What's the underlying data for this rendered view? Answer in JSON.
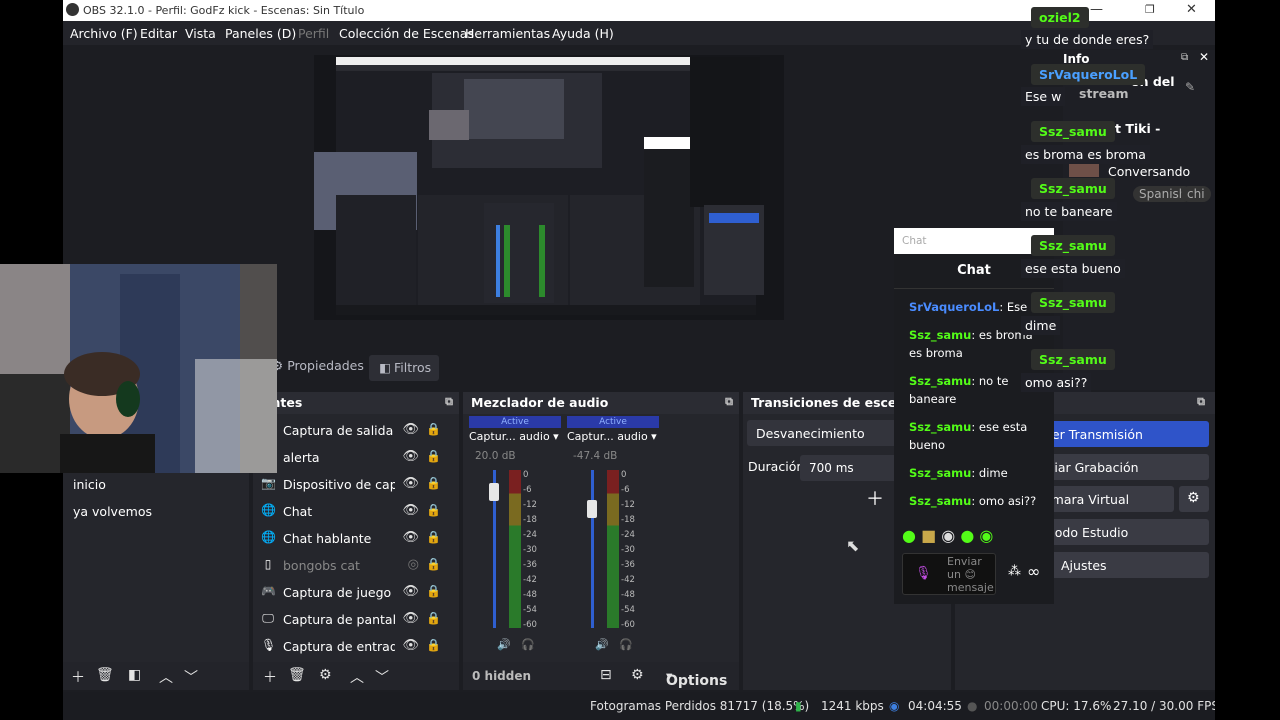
{
  "window": {
    "title": "OBS 32.1.0 - Perfil: GodFz kick - Escenas: Sin Título"
  },
  "menu": [
    "Archivo (F)",
    "Editar",
    "Vista",
    "Paneles (D)",
    "Perfil",
    "Colección de Escenas",
    "Herramientas",
    "Ayuda (H)"
  ],
  "toolbar_tabs": {
    "properties": "Propiedades",
    "filters": "Filtros"
  },
  "scenes": {
    "items": [
      "inicio",
      "ya volvemos"
    ]
  },
  "sources": {
    "title": "entes",
    "items": [
      {
        "icon": "window-capture-icon",
        "label": "Captura de salida de"
      },
      {
        "icon": "text-icon",
        "label": "alerta"
      },
      {
        "icon": "camera-icon",
        "label": "Dispositivo de captu"
      },
      {
        "icon": "globe-icon",
        "label": "Chat"
      },
      {
        "icon": "globe-icon",
        "label": "Chat hablante"
      },
      {
        "icon": "file-icon",
        "label": "bongobs cat"
      },
      {
        "icon": "gamepad-icon",
        "label": "Captura de juego"
      },
      {
        "icon": "monitor-icon",
        "label": "Captura de pantalla"
      },
      {
        "icon": "microphone-icon",
        "label": "Captura de entrada"
      }
    ]
  },
  "mixer": {
    "title": "Mezclador de audio",
    "channels": [
      {
        "active": "Active",
        "name": "Captur... audio",
        "db": "20.0 dB",
        "level": 0.08
      },
      {
        "active": "Active",
        "name": "Captur... audio",
        "db": "-47.4 dB",
        "level": 0.19
      }
    ],
    "scale": [
      "0",
      "-6",
      "-12",
      "-18",
      "-24",
      "-30",
      "-36",
      "-42",
      "-48",
      "-54",
      "-60"
    ],
    "hidden": "0 hidden",
    "options": "Options"
  },
  "transitions": {
    "title": "Transiciones de escena",
    "selected": "Desvanecimiento",
    "duration_label": "Duración",
    "duration": "700 ms"
  },
  "controls": {
    "stream": "ner Transmisión",
    "record": "iciar Grabación",
    "virtual_cam": "ámara Virtual",
    "studio": "Modo Estudio",
    "settings": "Ajustes"
  },
  "status": {
    "dropped": "Fotogramas Perdidos 81717 (18.5%)",
    "bitrate": "1241 kbps",
    "stream_time": "04:04:55",
    "rec_time": "00:00:00",
    "cpu": "CPU: 17.6%",
    "fps": "27.10 / 30.00 FPS"
  },
  "chat_popup": {
    "input_placeholder": "Chat",
    "title": "Chat",
    "messages": [
      {
        "user": "SrVaqueroLoL",
        "text": ": Ese w"
      },
      {
        "user": "Ssz_samu",
        "text": ": es broma es broma"
      },
      {
        "user": "Ssz_samu",
        "text": ": no te baneare"
      },
      {
        "user": "Ssz_samu",
        "text": ": ese esta bueno"
      },
      {
        "user": "Ssz_samu",
        "text": ": dime"
      },
      {
        "user": "Ssz_samu",
        "text": ": omo asi??"
      }
    ],
    "send_placeholder": "Enviar un 😊 mensaje",
    "accent": "#53fc18"
  },
  "overlay_chat": {
    "messages": [
      {
        "user": "oziel2",
        "text": "y tu de donde eres?"
      },
      {
        "user": "SrVaqueroLoL",
        "text": "Ese w"
      },
      {
        "user": "Ssz_samu",
        "text": "es broma es broma"
      },
      {
        "user": "Ssz_samu",
        "text": "no te baneare"
      },
      {
        "user": "Ssz_samu",
        "text": "ese esta bueno"
      },
      {
        "user": "Ssz_samu",
        "text": "dime"
      },
      {
        "user": "Ssz_samu",
        "text": "omo asi??"
      }
    ],
    "info_panel": {
      "header": "Info",
      "line1": "ón del",
      "line2": "stream",
      "line3": "t Tiki -",
      "line4": "Conversando",
      "tag1": "Spanish",
      "tag2": "chi"
    }
  }
}
